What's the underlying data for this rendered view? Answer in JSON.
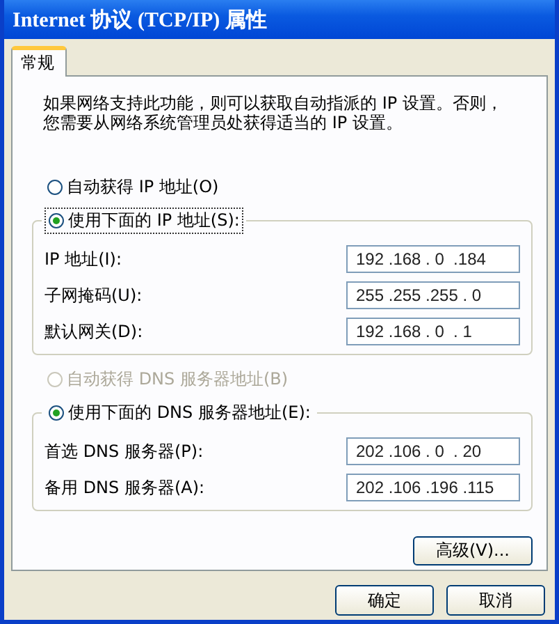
{
  "window": {
    "title": "Internet 协议 (TCP/IP) 属性"
  },
  "tabs": [
    {
      "label": "常规",
      "selected": true
    }
  ],
  "description_lines": [
    "如果网络支持此功能，则可以获取自动指派的 IP 设置。否则，",
    "您需要从网络系统管理员处获得适当的 IP 设置。"
  ],
  "ip_section": {
    "auto_option": {
      "label": "自动获得 IP 地址(O)",
      "selected": false,
      "disabled": false,
      "focused": false
    },
    "manual_option": {
      "label": "使用下面的 IP 地址(S):",
      "selected": true,
      "disabled": false,
      "focused": true
    },
    "fields": [
      {
        "label": "IP 地址(I):",
        "value": "192 .168 . 0  .184"
      },
      {
        "label": "子网掩码(U):",
        "value": "255 .255 .255 . 0"
      },
      {
        "label": "默认网关(D):",
        "value": "192 .168 . 0  . 1"
      }
    ]
  },
  "dns_section": {
    "auto_option": {
      "label": "自动获得 DNS 服务器地址(B)",
      "selected": false,
      "disabled": true,
      "focused": false
    },
    "manual_option": {
      "label": "使用下面的 DNS 服务器地址(E):",
      "selected": true,
      "disabled": false,
      "focused": false
    },
    "fields": [
      {
        "label": "首选 DNS 服务器(P):",
        "value": "202 .106 . 0  . 20"
      },
      {
        "label": "备用 DNS 服务器(A):",
        "value": "202 .106 .196 .115"
      }
    ]
  },
  "advanced_button": "高级(V)...",
  "buttons": [
    "确定",
    "取消"
  ]
}
